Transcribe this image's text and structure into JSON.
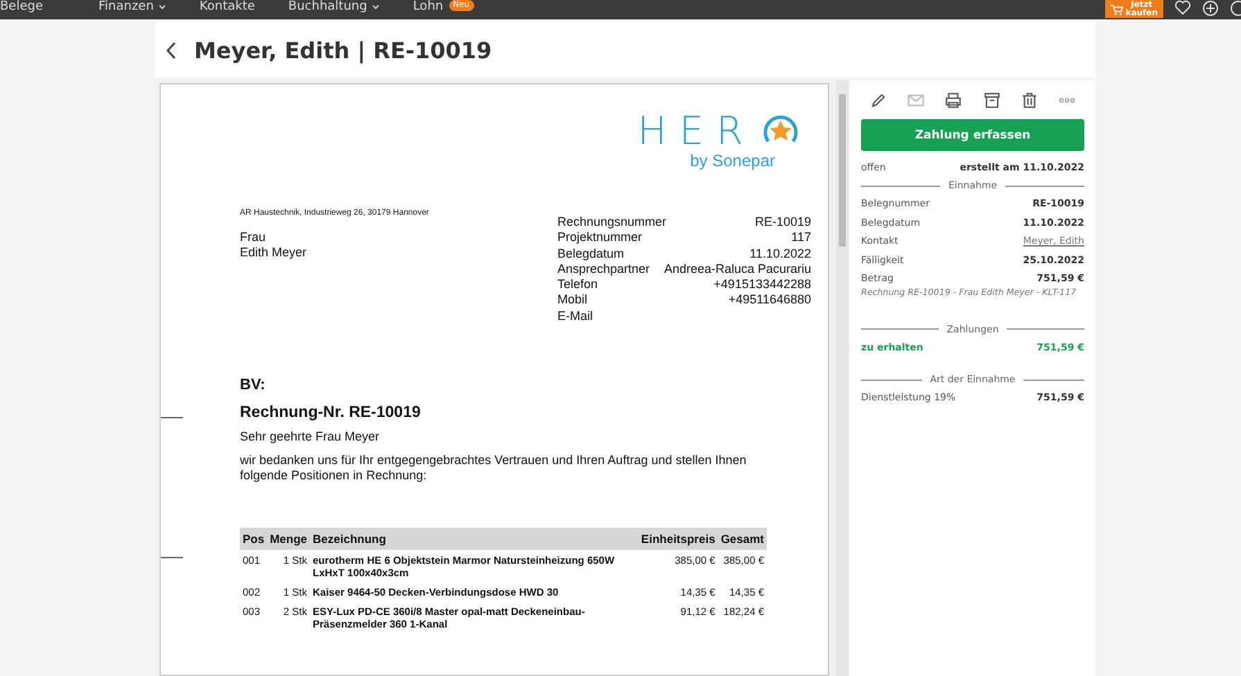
{
  "nav": {
    "items": [
      {
        "label": "Belege",
        "dropdown": false
      },
      {
        "label": "Finanzen",
        "dropdown": true
      },
      {
        "label": "Kontakte",
        "dropdown": false
      },
      {
        "label": "Buchhaltung",
        "dropdown": true
      },
      {
        "label": "Lohn",
        "dropdown": false,
        "badge": "Neu"
      }
    ],
    "buy_button": [
      "Jetzt",
      "kaufen"
    ]
  },
  "header": {
    "title": "Meyer, Edith | RE-10019"
  },
  "document": {
    "logo": {
      "wordmark": "HER",
      "tagline": "by Sonepar"
    },
    "sender_line": "AR Haustechnik, Industrieweg 26, 30179 Hannover",
    "recipient": [
      "Frau",
      "Edith Meyer"
    ],
    "info": [
      {
        "label": "Rechnungsnummer",
        "value": "RE-10019"
      },
      {
        "label": "Projektnummer",
        "value": "117"
      },
      {
        "label": "Belegdatum",
        "value": "11.10.2022"
      },
      {
        "label": "Ansprechpartner",
        "value": "Andreea-Raluca Pacurariu"
      },
      {
        "label": "Telefon",
        "value": "+4915133442288"
      },
      {
        "label": "Mobil",
        "value": "+49511646880"
      },
      {
        "label": "E-Mail"
      }
    ],
    "bv": "BV:",
    "heading": "Rechnung-Nr. RE-10019",
    "salutation": "Sehr geehrte Frau Meyer",
    "intro": "wir bedanken uns für Ihr entgegengebrachtes Vertrauen und Ihren Auftrag und stellen Ihnen folgende Positionen in Rechnung:",
    "table": {
      "columns": [
        "Pos",
        "Menge",
        "Bezeichnung",
        "Einheitspreis",
        "Gesamt"
      ],
      "rows": [
        [
          "001",
          "1 Stk",
          "eurotherm HE 6 Objektstein Marmor Natursteinheizung 650W LxHxT 100x40x3cm",
          "385,00 €",
          "385,00 €"
        ],
        [
          "002",
          "1 Stk",
          "Kaiser 9464-50 Decken-Verbindungsdose HWD 30",
          "14,35 €",
          "14,35 €"
        ],
        [
          "003",
          "2 Stk",
          "ESY-Lux PD-CE 360i/8 Master opal-matt Deckeneinbau-Präsenzmelder 360 1-Kanal",
          "91,12 €",
          "182,24 €"
        ]
      ]
    }
  },
  "sidebar": {
    "primary_button": "Zahlung erfassen",
    "status": "offen",
    "created": "erstellt am 11.10.2022",
    "sections": [
      {
        "title": "Einnahme",
        "rows": [
          {
            "label": "Belegnummer",
            "value": "RE-10019",
            "kind": "plain"
          },
          {
            "label": "Belegdatum",
            "value": "11.10.2022",
            "kind": "plain"
          },
          {
            "label": "Kontakt",
            "value": "Meyer, Edith",
            "kind": "link"
          },
          {
            "label": "Fälligkeit",
            "value": "25.10.2022",
            "kind": "plain"
          },
          {
            "label": "Betrag",
            "value": "751,59 €",
            "kind": "plain"
          }
        ],
        "note": "Rechnung RE-10019 - Frau Edith Meyer - KLT-117"
      },
      {
        "title": "Zahlungen",
        "rows": [
          {
            "label": "zu erhalten",
            "value": "751,59 €",
            "kind": "highlight"
          }
        ]
      },
      {
        "title": "Art der Einnahme",
        "rows": [
          {
            "label": "Dienstleistung 19%",
            "value": "751,59 €",
            "kind": "plain"
          }
        ]
      }
    ]
  }
}
